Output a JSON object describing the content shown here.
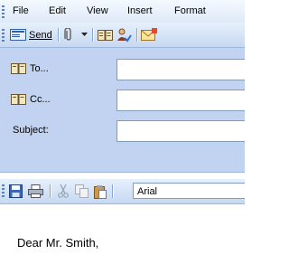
{
  "menu": {
    "file": "File",
    "edit": "Edit",
    "view": "View",
    "insert": "Insert",
    "format": "Format"
  },
  "toolbar": {
    "send_label": "Send"
  },
  "headers": {
    "to_label": "To...",
    "cc_label": "Cc...",
    "subject_label": "Subject:",
    "to_value": "",
    "cc_value": "",
    "subject_value": ""
  },
  "format_bar": {
    "font_name": "Arial"
  },
  "message": {
    "body_text": "Dear Mr. Smith,"
  },
  "colors": {
    "header_panel": "#c1d3f0",
    "toolbar_gradient_top": "#e7f0fc",
    "toolbar_gradient_bottom": "#c6d8f2",
    "field_border": "#7f9db9"
  }
}
